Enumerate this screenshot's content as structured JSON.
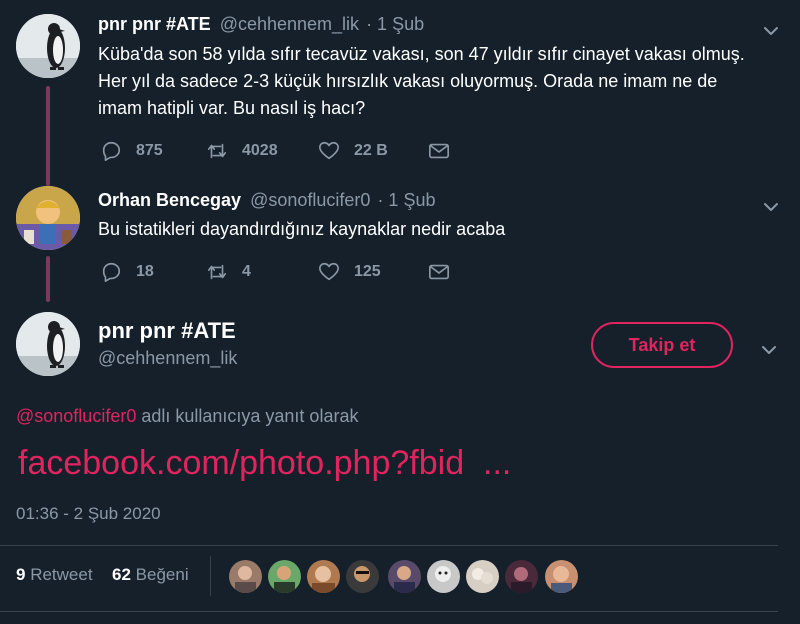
{
  "tweet1": {
    "display_name": "pnr pnr #ATE",
    "handle": "@cehhennem_lik",
    "time": "· 1 Şub",
    "text_lines": [
      "Küba'da son 58 yılda sıfır tecavüz vakası, son 47 yıldır sıfır  cinayet vakası olmuş.",
      "Her yıl da sadece 2-3 küçük hırsızlık vakası oluyormuş. Orada ne imam ne de",
      "imam hatipli var. Bu nasıl iş hacı?"
    ],
    "replies": "875",
    "retweets": "4028",
    "likes": "22 B"
  },
  "tweet2": {
    "display_name": "Orhan Bencegay",
    "handle": "@sonoflucifer0",
    "time": "· 1 Şub",
    "text": "Bu istatikleri dayandırdığınız kaynaklar nedir acaba",
    "replies": "18",
    "retweets": "4",
    "likes": "125"
  },
  "main": {
    "display_name": "pnr pnr #ATE",
    "handle": "@cehhennem_lik",
    "follow_label": "Takip et",
    "reply_to_mention": "@sonoflucifer0",
    "reply_to_text": " adlı kullanıcıya yanıt olarak",
    "link": "facebook.com/photo.php?fbid  ...",
    "timestamp": "01:36 - 2 Şub 2020",
    "retweet_count": "9",
    "retweet_label": "Retweet",
    "like_count": "62",
    "like_label": "Beğeni"
  },
  "colors": {
    "background": "#15202b",
    "accent": "#e0245e",
    "muted": "#8b99a6",
    "thread_line": "#7a3a5e"
  },
  "icons": [
    "reply-icon",
    "retweet-icon",
    "like-icon",
    "dm-icon",
    "chevron-down-icon"
  ]
}
